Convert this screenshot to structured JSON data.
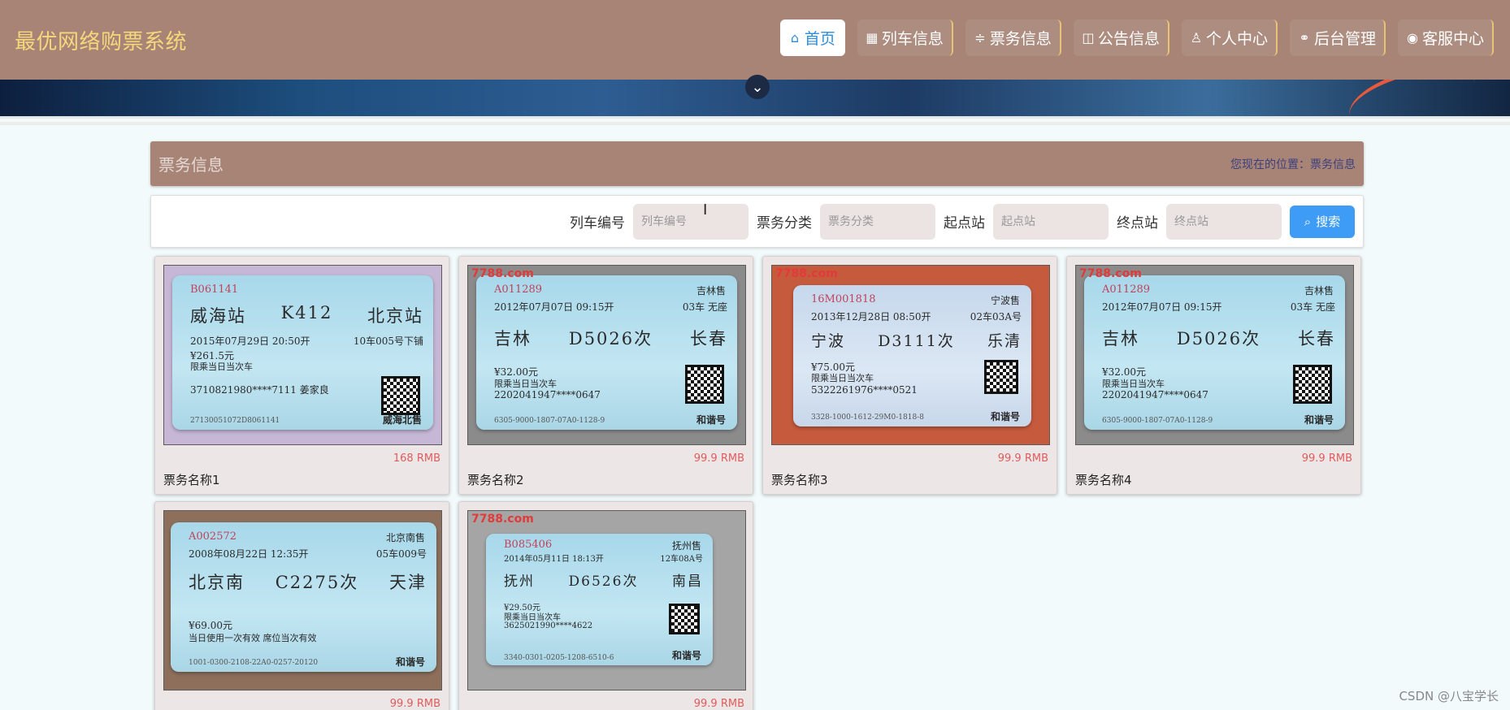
{
  "header": {
    "title": "最优网络购票系统",
    "nav": [
      {
        "icon": "⌂",
        "label": "首页",
        "name": "home"
      },
      {
        "icon": "▦",
        "label": "列车信息",
        "name": "train-info"
      },
      {
        "icon": "≑",
        "label": "票务信息",
        "name": "ticket-info"
      },
      {
        "icon": "◫",
        "label": "公告信息",
        "name": "notice-info"
      },
      {
        "icon": "♙",
        "label": "个人中心",
        "name": "personal-center"
      },
      {
        "icon": "⚭",
        "label": "后台管理",
        "name": "admin"
      },
      {
        "icon": "◉",
        "label": "客服中心",
        "name": "customer-service"
      }
    ]
  },
  "breadcrumb": {
    "title": "票务信息",
    "position": "您现在的位置：票务信息"
  },
  "search": {
    "fields": [
      {
        "label": "列车编号",
        "placeholder": "列车编号"
      },
      {
        "label": "票务分类",
        "placeholder": "票务分类"
      },
      {
        "label": "起点站",
        "placeholder": "起点站"
      },
      {
        "label": "终点站",
        "placeholder": "终点站"
      }
    ],
    "button": "搜索"
  },
  "cards": [
    {
      "name": "票务名称1",
      "price": "168 RMB",
      "watermark": "",
      "ticket": {
        "code": "B061141",
        "sale": "",
        "time": "2015年07月29日 20:50开",
        "seat": "10车005号下铺",
        "from": "威海站",
        "train": "K412",
        "to": "北京站",
        "price": "¥261.5元",
        "note": "限乘当日当次车",
        "id": "3710821980****7111 姜家良",
        "serial": "27130051072D8061141",
        "mark": "威海北售"
      }
    },
    {
      "name": "票务名称2",
      "price": "99.9 RMB",
      "watermark": "7788.com",
      "ticket": {
        "code": "A011289",
        "sale": "吉林售",
        "time": "2012年07月07日 09:15开",
        "seat": "03车 无座",
        "from": "吉林",
        "train": "D5026次",
        "to": "长春",
        "price": "¥32.00元",
        "note": "限乘当日当次车",
        "id": "2202041947****0647",
        "serial": "6305-9000-1807-07A0-1128-9",
        "mark": "和谐号"
      }
    },
    {
      "name": "票务名称3",
      "price": "99.9 RMB",
      "watermark": "7788.com",
      "ticket": {
        "code": "16M001818",
        "sale": "宁波售",
        "time": "2013年12月28日 08:50开",
        "seat": "02车03A号",
        "from": "宁波",
        "train": "D3111次",
        "to": "乐清",
        "price": "¥75.00元",
        "note": "限乘当日当次车",
        "id": "5322261976****0521",
        "serial": "3328-1000-1612-29M0-1818-8",
        "mark": "和谐号"
      }
    },
    {
      "name": "票务名称4",
      "price": "99.9 RMB",
      "watermark": "7788.com",
      "ticket": {
        "code": "A011289",
        "sale": "吉林售",
        "time": "2012年07月07日 09:15开",
        "seat": "03车 无座",
        "from": "吉林",
        "train": "D5026次",
        "to": "长春",
        "price": "¥32.00元",
        "note": "限乘当日当次车",
        "id": "2202041947****0647",
        "serial": "6305-9000-1807-07A0-1128-9",
        "mark": "和谐号"
      }
    },
    {
      "name": "",
      "price": "99.9 RMB",
      "watermark": "",
      "ticket": {
        "code": "A002572",
        "sale": "北京南售",
        "time": "2008年08月22日 12:35开",
        "seat": "05车009号",
        "from": "北京南",
        "train": "C2275次",
        "to": "天津",
        "price": "¥69.00元",
        "note": "当日使用一次有效 席位当次有效",
        "id": "",
        "serial": "1001-0300-2108-22A0-0257-20120",
        "mark": "和谐号"
      }
    },
    {
      "name": "",
      "price": "99.9 RMB",
      "watermark": "7788.com",
      "ticket": {
        "code": "B085406",
        "sale": "抚州售",
        "time": "2014年05月11日 18:13开",
        "seat": "12车08A号",
        "from": "抚州",
        "train": "D6526次",
        "to": "南昌",
        "price": "¥29.50元",
        "note": "限乘当日当次车",
        "id": "3625021990****4622",
        "serial": "3340-0301-0205-1208-6510-6",
        "mark": "和谐号"
      }
    }
  ],
  "credit": "CSDN @八宝学长"
}
